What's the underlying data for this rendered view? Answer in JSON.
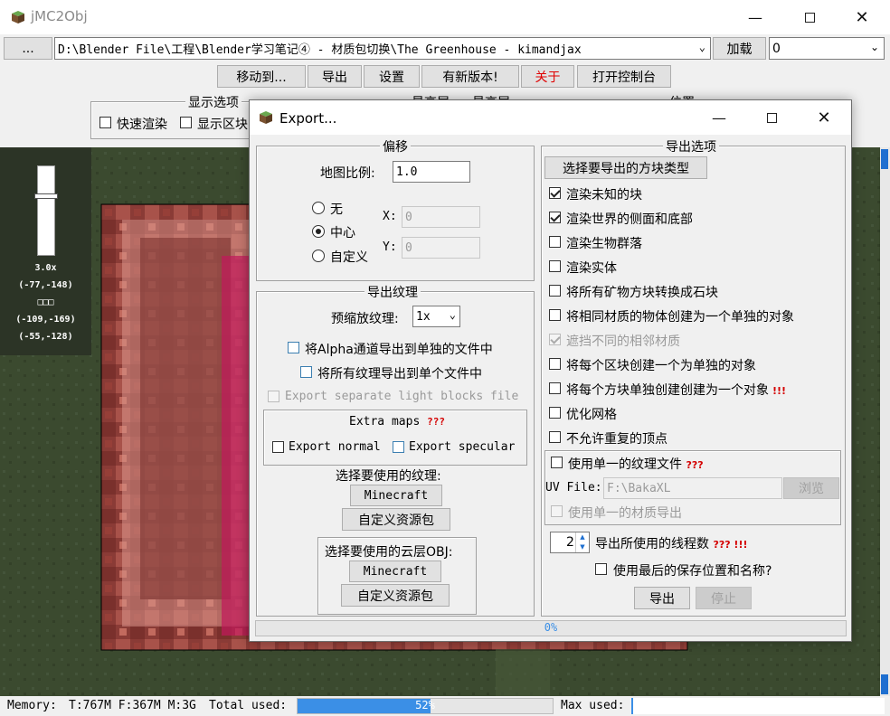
{
  "main_window": {
    "title": "jMC2Obj",
    "path_button": "...",
    "path_value": "D:\\Blender File\\工程\\Blender学习笔记④ - 材质包切换\\The Greenhouse - kimandjax",
    "load_button": "加载",
    "dimension_value": "0",
    "toolbar": {
      "move_to": "移动到...",
      "export": "导出",
      "settings": "设置",
      "new_version": "有新版本!",
      "about": "关于",
      "console": "打开控制台"
    },
    "display_options_title": "显示选项",
    "fast_render": "快速渲染",
    "show_chunks": "显示区块",
    "min_layer_label": "最高层",
    "max_layer_label": "最高层",
    "position_label": "位置",
    "zoom": "3.0x",
    "coord1": "(-77,-148)",
    "coord_sep": "□□□",
    "coord2": "(-109,-169)",
    "coord3": "(-55,-128)",
    "memory": {
      "label": "Memory:",
      "values": "T:767M F:367M M:3G",
      "total_label": "Total used:",
      "total_pct": "52%",
      "total_fraction": 0.52,
      "max_label": "Max used:"
    }
  },
  "export_dialog": {
    "title": "Export...",
    "offset": {
      "title": "偏移",
      "map_scale_label": "地图比例:",
      "map_scale_value": "1.0",
      "opt_none": "无",
      "opt_center": "中心",
      "opt_custom": "自定义",
      "x_label": "X:",
      "x_value": "0",
      "y_label": "Y:",
      "y_value": "0"
    },
    "textures": {
      "title": "导出纹理",
      "prescale_label": "预缩放纹理:",
      "prescale_value": "1x",
      "alpha_separate": "将Alpha通道导出到单独的文件中",
      "all_single": "将所有纹理导出到单个文件中",
      "light_blocks": "Export separate light blocks file",
      "extra_maps_title": "Extra maps",
      "extra_maps_marks": "???",
      "export_normal": "Export normal",
      "export_specular": "Export specular",
      "choose_texture": "选择要使用的纹理:",
      "minecraft": "Minecraft",
      "custom_pack": "自定义资源包",
      "cloud_obj": "选择要使用的云层OBJ:",
      "cloud_minecraft": "Minecraft",
      "cloud_custom_pack": "自定义资源包"
    },
    "options": {
      "title": "导出选项",
      "choose_blocks": "选择要导出的方块类型",
      "items": [
        {
          "label": "渲染未知的块",
          "checked": true,
          "disabled": false,
          "marks": ""
        },
        {
          "label": "渲染世界的侧面和底部",
          "checked": true,
          "disabled": false,
          "marks": ""
        },
        {
          "label": "渲染生物群落",
          "checked": false,
          "disabled": false,
          "marks": ""
        },
        {
          "label": "渲染实体",
          "checked": false,
          "disabled": false,
          "marks": ""
        },
        {
          "label": "将所有矿物方块转换成石块",
          "checked": false,
          "disabled": false,
          "marks": ""
        },
        {
          "label": "将相同材质的物体创建为一个单独的对象",
          "checked": false,
          "disabled": false,
          "marks": ""
        },
        {
          "label": "遮挡不同的相邻材质",
          "checked": true,
          "disabled": true,
          "marks": ""
        },
        {
          "label": "将每个区块创建一个为单独的对象",
          "checked": false,
          "disabled": false,
          "marks": ""
        },
        {
          "label": "将每个方块单独创建创建为一个对象",
          "checked": false,
          "disabled": false,
          "marks": "!!!"
        },
        {
          "label": "优化网格",
          "checked": false,
          "disabled": false,
          "marks": ""
        },
        {
          "label": "不允许重复的顶点",
          "checked": false,
          "disabled": false,
          "marks": ""
        }
      ],
      "single_texture": "使用单一的纹理文件",
      "single_texture_marks": "???",
      "uv_label": "UV File:",
      "uv_value": "F:\\BakaXL",
      "browse": "浏览",
      "single_material": "使用单一的材质导出",
      "threads_value": "2",
      "threads_label": "导出所使用的线程数",
      "threads_marks": "??? !!!",
      "use_last": "使用最后的保存位置和名称?",
      "export_button": "导出",
      "stop_button": "停止"
    },
    "progress_text": "0%",
    "progress_fraction": 0
  },
  "colors": {
    "about_red": "#e00000",
    "progress_blue": "#3b8fe6",
    "map_green": "#3a4a2e"
  }
}
